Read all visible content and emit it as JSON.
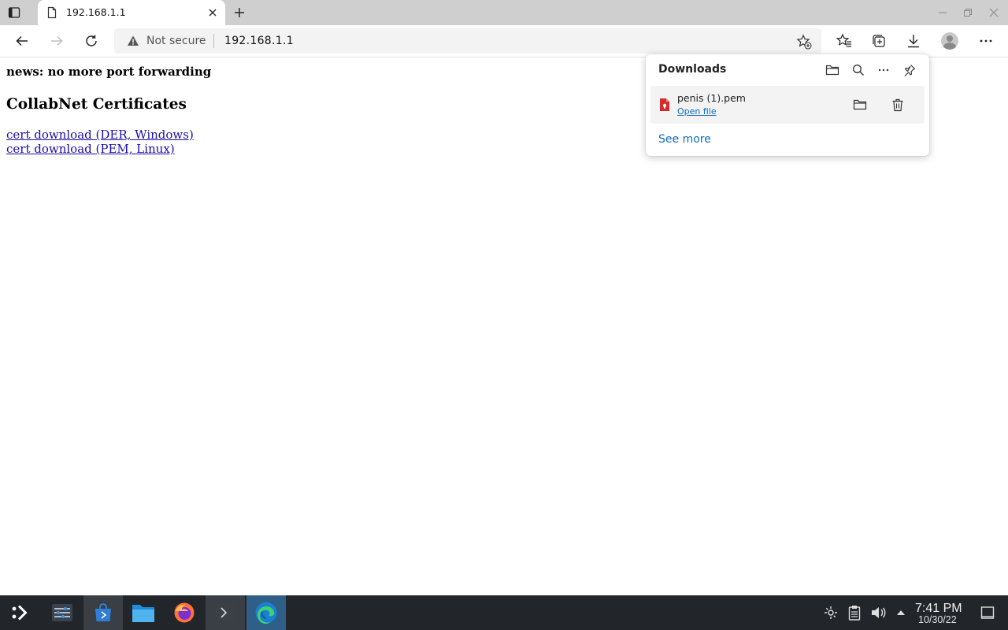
{
  "tab": {
    "title": "192.168.1.1"
  },
  "omnibox": {
    "security_label": "Not secure",
    "url": "192.168.1.1"
  },
  "page": {
    "news": "news: no more port forwarding",
    "heading": "CollabNet Certificates",
    "links": [
      "cert download (DER, Windows)",
      "cert download (PEM, Linux)"
    ]
  },
  "downloads": {
    "title": "Downloads",
    "items": [
      {
        "filename": "penis (1).pem",
        "action": "Open file"
      }
    ],
    "see_more": "See more"
  },
  "clock": {
    "time": "7:41 PM",
    "date": "10/30/22"
  },
  "colors": {
    "link": "#1a0dab",
    "accent": "#0f6cbd",
    "taskbar": "#22262b",
    "tabstrip": "#cfcfcf"
  }
}
